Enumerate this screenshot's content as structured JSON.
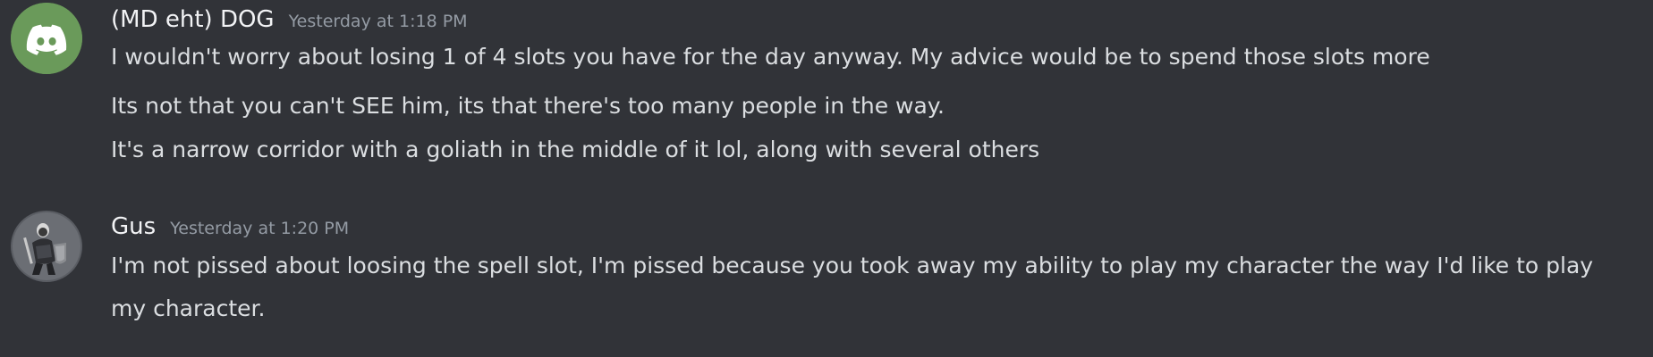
{
  "messages": [
    {
      "username": "(MD eht) DOG",
      "timestamp": "Yesterday at 1:18 PM",
      "avatar_icon": "discord-logo-icon",
      "avatar_color": "#6a9a5a",
      "lines": [
        "I wouldn't worry about losing 1 of 4 slots you have for the day anyway.  My advice would be to spend those slots more",
        "Its not that you can't SEE him, its that there's too many people in the way.",
        "It's a narrow corridor with a goliath in the middle of it lol, along with several others"
      ]
    },
    {
      "username": "Gus",
      "timestamp": "Yesterday at 1:20 PM",
      "avatar_icon": "armored-warrior-avatar-icon",
      "lines": [
        "I'm not pissed about loosing the spell slot, I'm pissed because you took away my ability to play my character the way I'd like to play my character."
      ]
    }
  ],
  "colors": {
    "background": "#313338",
    "username": "#f2f3f5",
    "timestamp": "#949ba4",
    "message_text": "#dbdee1"
  }
}
